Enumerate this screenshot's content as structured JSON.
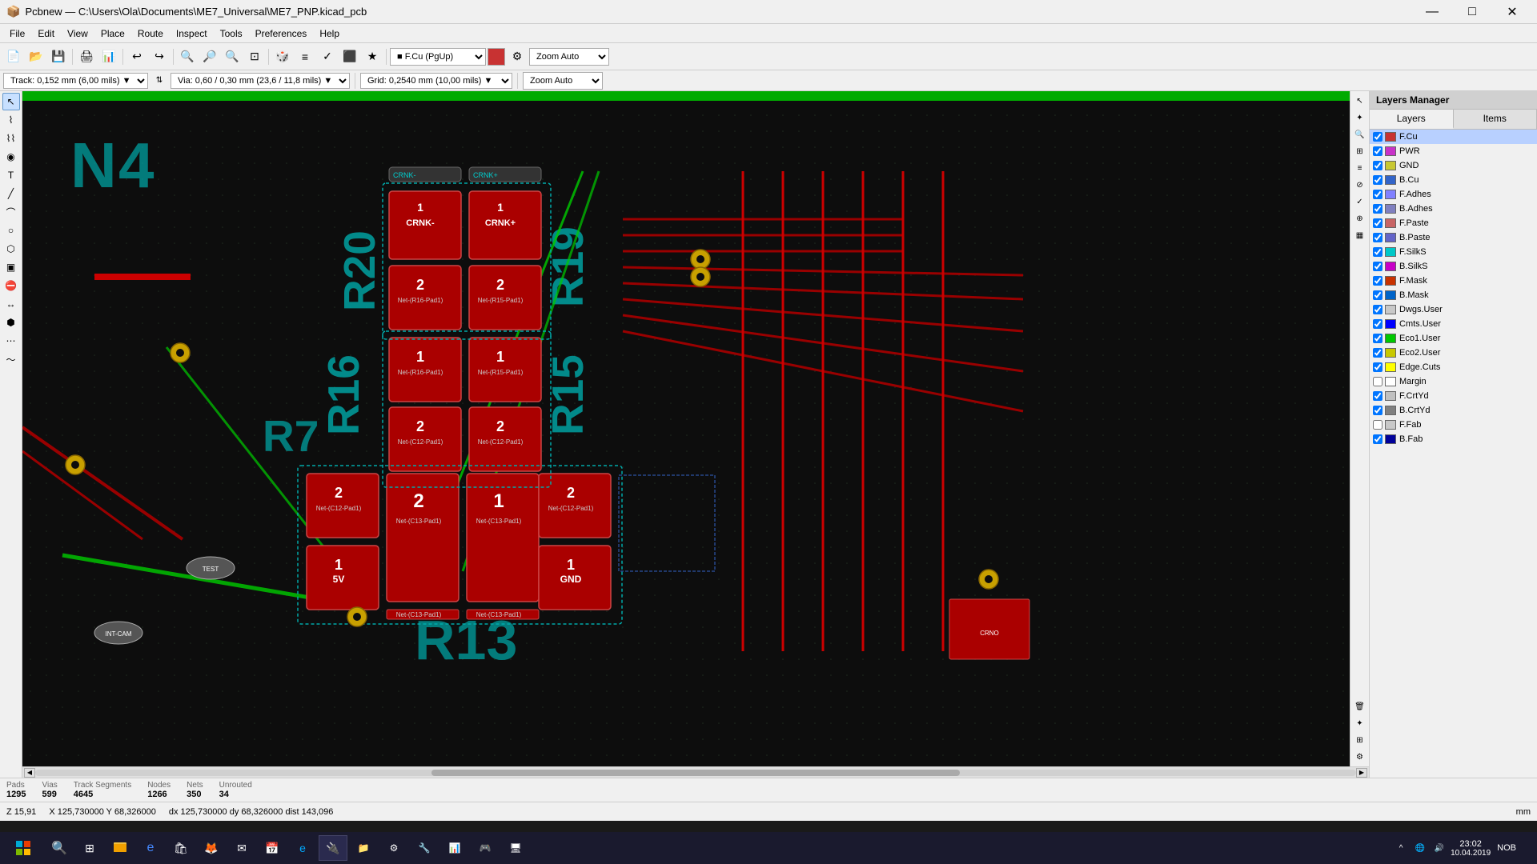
{
  "titlebar": {
    "title": "Pcbnew — C:\\Users\\Ola\\Documents\\ME7_Universal\\ME7_PNP.kicad_pcb",
    "minimize": "—",
    "maximize": "□",
    "close": "✕"
  },
  "menu": {
    "items": [
      "File",
      "Edit",
      "View",
      "Place",
      "Route",
      "Inspect",
      "Tools",
      "Preferences",
      "Help"
    ]
  },
  "trackbar": {
    "track_label": "Track: 0,152 mm (6,00 mils) ▼",
    "via_label": "Via: 0,60 / 0,30 mm (23,6 / 11,8 mils) ▼",
    "grid_label": "Grid: 0,2540 mm (10,00 mils) ▼",
    "zoom_label": "Zoom Auto"
  },
  "layers_manager": {
    "title": "Layers Manager",
    "tabs": [
      "Layers",
      "Items"
    ],
    "layers": [
      {
        "name": "F.Cu",
        "color": "#c83232",
        "checked": true,
        "selected": true
      },
      {
        "name": "PWR",
        "color": "#c832c8",
        "checked": true,
        "selected": false
      },
      {
        "name": "GND",
        "color": "#c8c832",
        "checked": true,
        "selected": false
      },
      {
        "name": "B.Cu",
        "color": "#3264c8",
        "checked": true,
        "selected": false
      },
      {
        "name": "F.Adhes",
        "color": "#8080ff",
        "checked": true,
        "selected": false
      },
      {
        "name": "B.Adhes",
        "color": "#8080c0",
        "checked": true,
        "selected": false
      },
      {
        "name": "F.Paste",
        "color": "#c86464",
        "checked": true,
        "selected": false
      },
      {
        "name": "B.Paste",
        "color": "#6464c8",
        "checked": true,
        "selected": false
      },
      {
        "name": "F.SilkS",
        "color": "#00c8c8",
        "checked": true,
        "selected": false
      },
      {
        "name": "B.SilkS",
        "color": "#c800c8",
        "checked": true,
        "selected": false
      },
      {
        "name": "F.Mask",
        "color": "#c83200",
        "checked": true,
        "selected": false
      },
      {
        "name": "B.Mask",
        "color": "#0064c8",
        "checked": true,
        "selected": false
      },
      {
        "name": "Dwgs.User",
        "color": "#c8c8c8",
        "checked": true,
        "selected": false
      },
      {
        "name": "Cmts.User",
        "color": "#0000ff",
        "checked": true,
        "selected": false
      },
      {
        "name": "Eco1.User",
        "color": "#00c800",
        "checked": true,
        "selected": false
      },
      {
        "name": "Eco2.User",
        "color": "#c8c800",
        "checked": true,
        "selected": false
      },
      {
        "name": "Edge.Cuts",
        "color": "#ffff00",
        "checked": true,
        "selected": false
      },
      {
        "name": "Margin",
        "color": "#ffffff",
        "checked": false,
        "selected": false
      },
      {
        "name": "F.CrtYd",
        "color": "#c0c0c0",
        "checked": true,
        "selected": false
      },
      {
        "name": "B.CrtYd",
        "color": "#808080",
        "checked": true,
        "selected": false
      },
      {
        "name": "F.Fab",
        "color": "#c8c8c8",
        "checked": false,
        "selected": false
      },
      {
        "name": "B.Fab",
        "color": "#00009a",
        "checked": true,
        "selected": false
      }
    ]
  },
  "statusbar": {
    "pads_label": "Pads",
    "pads_value": "1295",
    "vias_label": "Vias",
    "vias_value": "599",
    "track_segments_label": "Track Segments",
    "track_segments_value": "4645",
    "nodes_label": "Nodes",
    "nodes_value": "1266",
    "nets_label": "Nets",
    "nets_value": "350",
    "unrouted_label": "Unrouted",
    "unrouted_value": "34"
  },
  "coordbar": {
    "z": "Z 15,91",
    "xy": "X 125,730000  Y 68,326000",
    "dxy": "dx 125,730000  dy 68,326000  dist 143,096",
    "units": "mm"
  },
  "taskbar": {
    "time": "23:02",
    "date": "10.04.2019",
    "language": "NOB"
  },
  "icons": {
    "cursor": "↖",
    "route": "⌇",
    "zoom_in": "+",
    "zoom_out": "−",
    "grid": "⋮",
    "inspect": "🔍",
    "settings": "⚙"
  }
}
